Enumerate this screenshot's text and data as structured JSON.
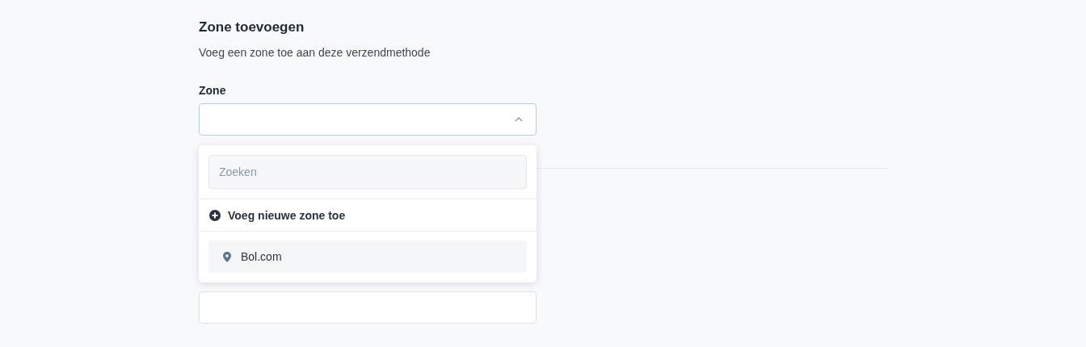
{
  "heading": "Zone toevoegen",
  "description": "Voeg een zone toe aan deze verzendmethode",
  "zone_field": {
    "label": "Zone",
    "expanded": true
  },
  "dropdown": {
    "search": {
      "placeholder": "Zoeken"
    },
    "add_action": {
      "label": "Voeg nieuwe zone toe"
    },
    "options": [
      {
        "label": "Bol.com",
        "highlighted": true
      }
    ]
  }
}
